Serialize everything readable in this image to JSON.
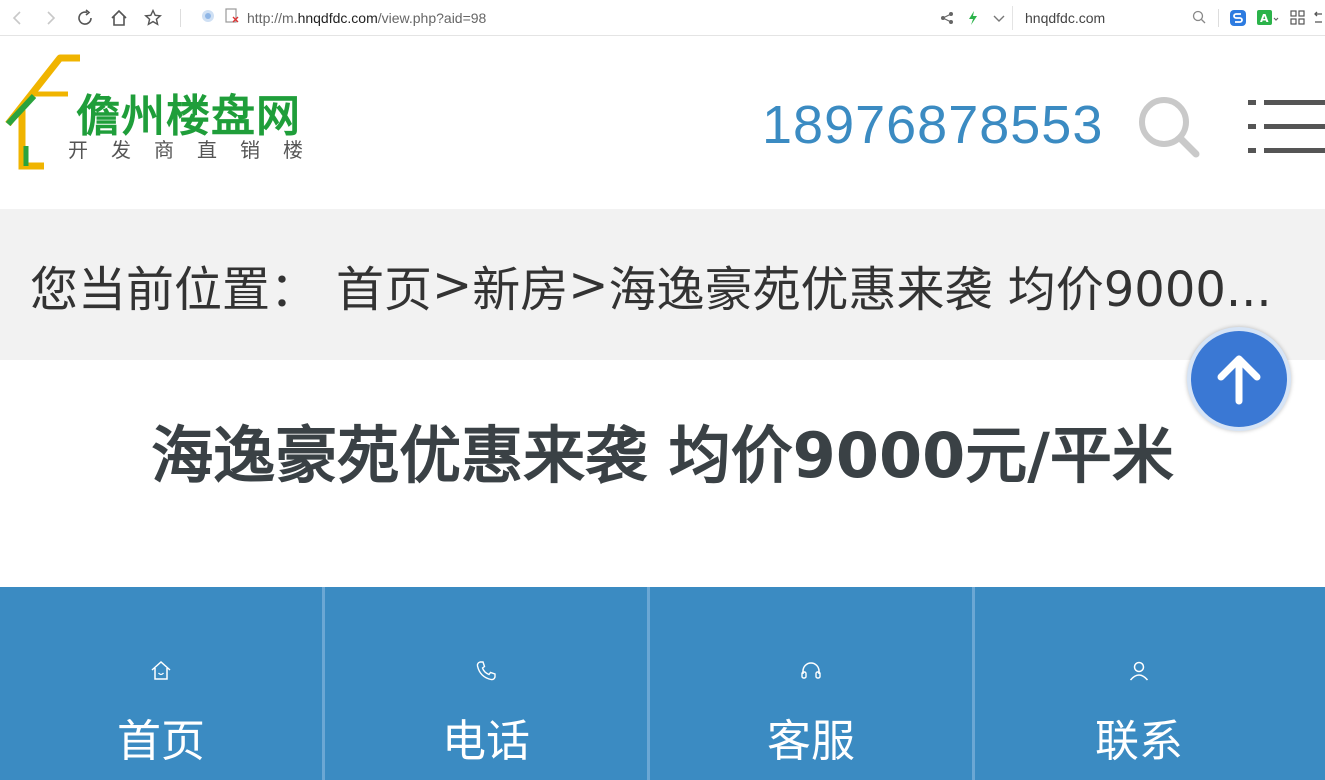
{
  "browser": {
    "url_prefix": "http://m.",
    "url_domain": "hnqdfdc.com",
    "url_path": "/view.php?aid=98",
    "search_text": "hnqdfdc.com"
  },
  "header": {
    "logo_title": "儋州楼盘网",
    "logo_sub": [
      "开",
      "发",
      "商",
      "直",
      "销",
      "楼"
    ],
    "phone": "18976878553"
  },
  "breadcrumb": {
    "label": "您当前位置：",
    "home": "首页",
    "sep1": ">",
    "category": "新房",
    "sep2": ">",
    "current": "海逸豪苑优惠来袭 均价9000..."
  },
  "article": {
    "title": "海逸豪苑优惠来袭 均价9000元/平米"
  },
  "bottom_nav": {
    "items": [
      {
        "label": "首页",
        "icon": "home-icon"
      },
      {
        "label": "电话",
        "icon": "phone-icon"
      },
      {
        "label": "客服",
        "icon": "headset-icon"
      },
      {
        "label": "联系",
        "icon": "user-icon"
      }
    ]
  },
  "colors": {
    "brand_green": "#1f9e3a",
    "accent_blue": "#3b8bc2",
    "back_top_blue": "#3a78d4"
  }
}
